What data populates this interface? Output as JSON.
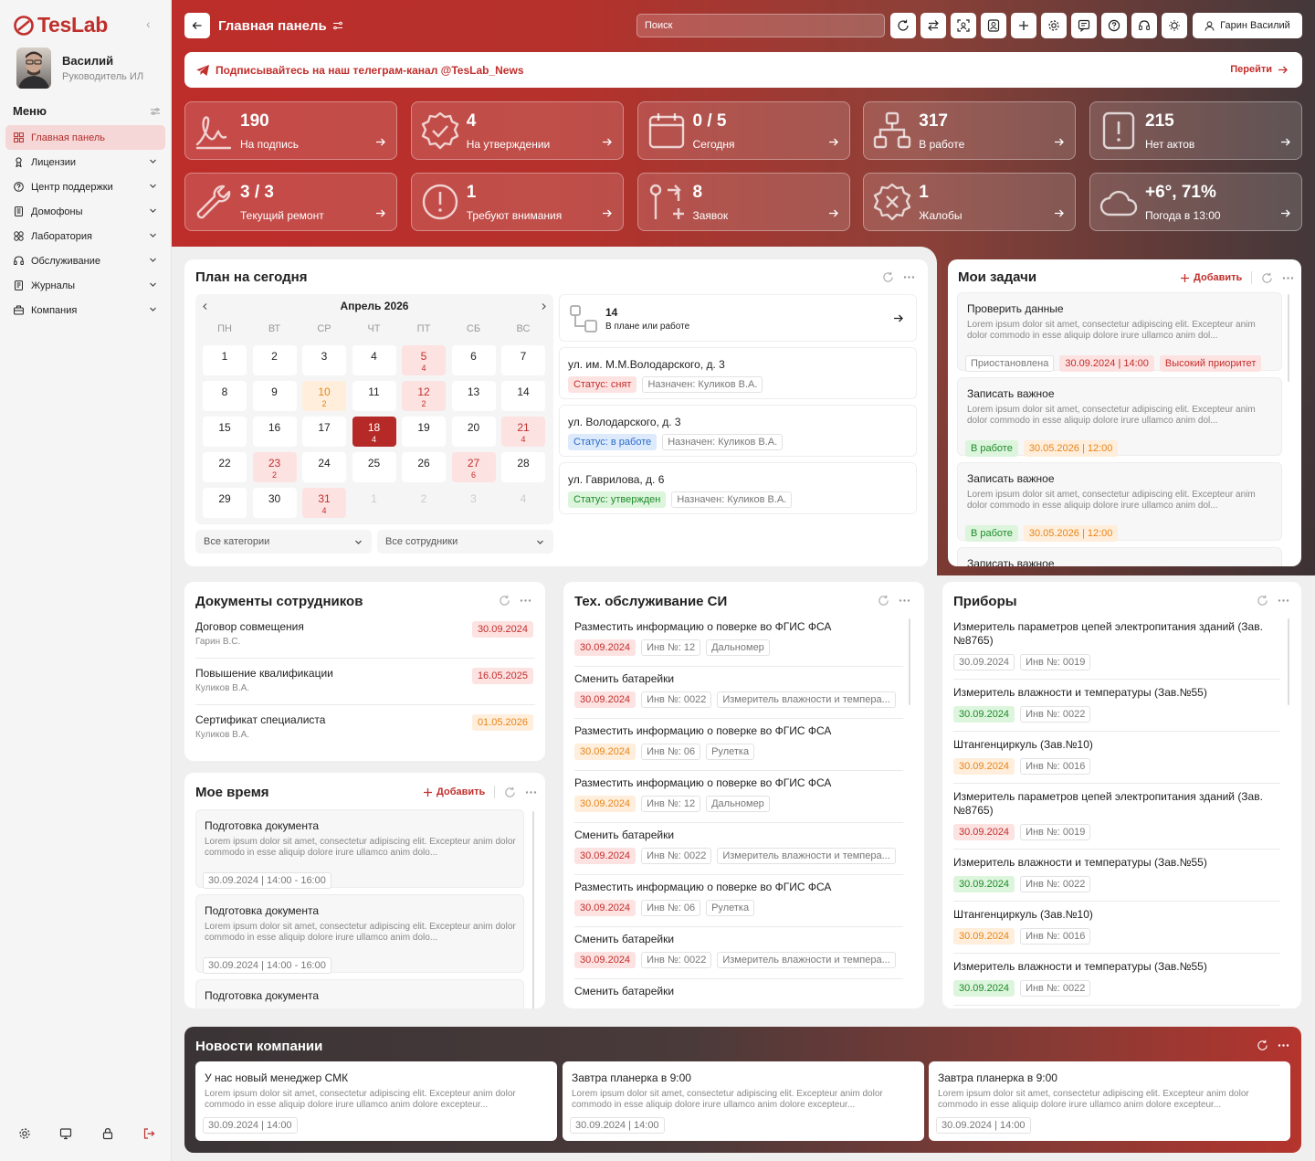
{
  "brand": {
    "logo": "TesLab"
  },
  "user": {
    "name": "Василий",
    "role": "Руководитель ИЛ"
  },
  "menu": {
    "title": "Меню",
    "items": [
      {
        "label": "Главная панель",
        "icon": "dashboard-icon"
      },
      {
        "label": "Лицензии",
        "icon": "license-icon"
      },
      {
        "label": "Центр поддержки",
        "icon": "support-icon"
      },
      {
        "label": "Домофоны",
        "icon": "intercom-icon"
      },
      {
        "label": "Лаборатория",
        "icon": "lab-icon"
      },
      {
        "label": "Обслуживание",
        "icon": "service-icon"
      },
      {
        "label": "Журналы",
        "icon": "journal-icon"
      },
      {
        "label": "Компания",
        "icon": "company-icon"
      }
    ]
  },
  "header": {
    "title": "Главная панель",
    "search_placeholder": "Поиск",
    "user_button": "Гарин Василий"
  },
  "banner": {
    "text": "Подписывайтесь на наш телеграм-канал @TesLab_News",
    "action": "Перейти"
  },
  "stats": [
    {
      "value": "190",
      "label": "На подпись",
      "icon": "signature-icon"
    },
    {
      "value": "4",
      "label": "На утверждении",
      "icon": "approval-icon"
    },
    {
      "value": "0 / 5",
      "label": "Сегодня",
      "icon": "calendar-icon"
    },
    {
      "value": "317",
      "label": "В работе",
      "icon": "hierarchy-icon"
    },
    {
      "value": "215",
      "label": "Нет актов",
      "icon": "alert-doc-icon"
    },
    {
      "value": "3 / 3",
      "label": "Текущий ремонт",
      "icon": "wrench-icon"
    },
    {
      "value": "1",
      "label": "Требуют внимания",
      "icon": "warning-icon"
    },
    {
      "value": "8",
      "label": "Заявок",
      "icon": "request-icon"
    },
    {
      "value": "1",
      "label": "Жалобы",
      "icon": "complaint-icon"
    },
    {
      "value": "+6°, 71%",
      "label": "Погода в 13:00",
      "icon": "cloud-icon"
    }
  ],
  "plan": {
    "title": "План на сегодня",
    "month": "Апрель 2026",
    "dows": [
      "ПН",
      "ВТ",
      "СР",
      "ЧТ",
      "ПТ",
      "СБ",
      "ВС"
    ],
    "days": [
      {
        "d": "1",
        "n": ""
      },
      {
        "d": "2",
        "n": ""
      },
      {
        "d": "3",
        "n": ""
      },
      {
        "d": "4",
        "n": ""
      },
      {
        "d": "5",
        "n": "4",
        "s": "ev"
      },
      {
        "d": "6",
        "n": ""
      },
      {
        "d": "7",
        "n": ""
      },
      {
        "d": "8",
        "n": ""
      },
      {
        "d": "9",
        "n": ""
      },
      {
        "d": "10",
        "n": "2",
        "s": "warn"
      },
      {
        "d": "11",
        "n": ""
      },
      {
        "d": "12",
        "n": "2",
        "s": "ev"
      },
      {
        "d": "13",
        "n": ""
      },
      {
        "d": "14",
        "n": ""
      },
      {
        "d": "15",
        "n": ""
      },
      {
        "d": "16",
        "n": ""
      },
      {
        "d": "17",
        "n": ""
      },
      {
        "d": "18",
        "n": "4",
        "s": "today"
      },
      {
        "d": "19",
        "n": ""
      },
      {
        "d": "20",
        "n": ""
      },
      {
        "d": "21",
        "n": "4",
        "s": "ev"
      },
      {
        "d": "22",
        "n": ""
      },
      {
        "d": "23",
        "n": "2",
        "s": "ev"
      },
      {
        "d": "24",
        "n": ""
      },
      {
        "d": "25",
        "n": ""
      },
      {
        "d": "26",
        "n": ""
      },
      {
        "d": "27",
        "n": "6",
        "s": "ev"
      },
      {
        "d": "28",
        "n": ""
      },
      {
        "d": "29",
        "n": ""
      },
      {
        "d": "30",
        "n": ""
      },
      {
        "d": "31",
        "n": "4",
        "s": "ev"
      },
      {
        "d": "1",
        "n": "",
        "s": "off"
      },
      {
        "d": "2",
        "n": "",
        "s": "off"
      },
      {
        "d": "3",
        "n": "",
        "s": "off"
      },
      {
        "d": "4",
        "n": "",
        "s": "off"
      }
    ],
    "filter_category": "Все категории",
    "filter_staff": "Все сотрудники",
    "summary": {
      "count": "14",
      "label": "В плане или работе"
    },
    "addresses": [
      {
        "addr": "ул. им. М.М.Володарского, д. 3",
        "status": "Статус: снят",
        "status_color": "red",
        "assignee": "Назначен: Куликов В.А."
      },
      {
        "addr": "ул. Володарского, д. 3",
        "status": "Статус: в работе",
        "status_color": "blue",
        "assignee": "Назначен: Куликов В.А."
      },
      {
        "addr": "ул. Гаврилова, д. 6",
        "status": "Статус: утвержден",
        "status_color": "green",
        "assignee": "Назначен: Куликов В.А."
      }
    ]
  },
  "tasks": {
    "title": "Мои задачи",
    "add": "Добавить",
    "items": [
      {
        "title": "Проверить данные",
        "desc": "Lorem ipsum dolor sit amet, consectetur adipiscing elit. Excepteur anim dolor commodo in esse aliquip dolore irure ullamco anim dol...",
        "tags": [
          {
            "t": "Приостановлена",
            "c": ""
          },
          {
            "t": "30.09.2024 | 14:00",
            "c": "red"
          },
          {
            "t": "Высокий приоритет",
            "c": "red"
          }
        ]
      },
      {
        "title": "Записать важное",
        "desc": "Lorem ipsum dolor sit amet, consectetur adipiscing elit. Excepteur anim dolor commodo in esse aliquip dolore irure ullamco anim dol...",
        "tags": [
          {
            "t": "В работе",
            "c": "green"
          },
          {
            "t": "30.05.2026 | 12:00",
            "c": "orange"
          }
        ]
      },
      {
        "title": "Записать важное",
        "desc": "Lorem ipsum dolor sit amet, consectetur adipiscing elit. Excepteur anim dolor commodo in esse aliquip dolore irure ullamco anim dol...",
        "tags": [
          {
            "t": "В работе",
            "c": "green"
          },
          {
            "t": "30.05.2026 | 12:00",
            "c": "orange"
          }
        ]
      },
      {
        "title": "Записать важное",
        "desc": "",
        "tags": []
      }
    ]
  },
  "docs": {
    "title": "Документы сотрудников",
    "items": [
      {
        "title": "Договор совмещения",
        "person": "Гарин В.С.",
        "date": "30.09.2024",
        "c": "red"
      },
      {
        "title": "Повышение квалификации",
        "person": "Куликов В.А.",
        "date": "16.05.2025",
        "c": "red"
      },
      {
        "title": "Сертификат специалиста",
        "person": "Куликов В.А.",
        "date": "01.05.2026",
        "c": "orange"
      }
    ]
  },
  "time": {
    "title": "Мое время",
    "add": "Добавить",
    "items": [
      {
        "title": "Подготовка документа",
        "desc": "Lorem ipsum dolor sit amet, consectetur adipiscing elit. Excepteur anim dolor commodo in esse aliquip dolore irure ullamco anim dolo...",
        "tag": "30.09.2024 | 14:00 - 16:00"
      },
      {
        "title": "Подготовка документа",
        "desc": "Lorem ipsum dolor sit amet, consectetur adipiscing elit. Excepteur anim dolor commodo in esse aliquip dolore irure ullamco anim dolo...",
        "tag": "30.09.2024 | 14:00 - 16:00"
      },
      {
        "title": "Подготовка документа",
        "desc": "",
        "tag": ""
      }
    ]
  },
  "maint": {
    "title": "Тех. обслуживание СИ",
    "items": [
      {
        "title": "Разместить информацию о поверке во ФГИС ФСА",
        "date": "30.09.2024",
        "c": "red",
        "inv": "Инв №: 12",
        "dev": "Дальномер"
      },
      {
        "title": "Сменить батарейки",
        "date": "30.09.2024",
        "c": "red",
        "inv": "Инв №: 0022",
        "dev": "Измеритель влажности и темпера..."
      },
      {
        "title": "Разместить информацию о поверке во ФГИС ФСА",
        "date": "30.09.2024",
        "c": "orange",
        "inv": "Инв №: 06",
        "dev": "Рулетка"
      },
      {
        "title": "Разместить информацию о поверке во ФГИС ФСА",
        "date": "30.09.2024",
        "c": "orange",
        "inv": "Инв №: 12",
        "dev": "Дальномер"
      },
      {
        "title": "Сменить батарейки",
        "date": "30.09.2024",
        "c": "red",
        "inv": "Инв №: 0022",
        "dev": "Измеритель влажности и темпера..."
      },
      {
        "title": "Разместить информацию о поверке во ФГИС ФСА",
        "date": "30.09.2024",
        "c": "red",
        "inv": "Инв №: 06",
        "dev": "Рулетка"
      },
      {
        "title": "Сменить батарейки",
        "date": "30.09.2024",
        "c": "red",
        "inv": "Инв №: 0022",
        "dev": "Измеритель влажности и темпера..."
      },
      {
        "title": "Сменить батарейки",
        "date": "",
        "c": "red",
        "inv": "",
        "dev": ""
      }
    ]
  },
  "devices": {
    "title": "Приборы",
    "items": [
      {
        "title": "Измеритель параметров цепей электропитания зданий (Зав.№8765)",
        "date": "30.09.2024",
        "c": "",
        "inv": "Инв №: 0019"
      },
      {
        "title": "Измеритель влажности и температуры (Зав.№55)",
        "date": "30.09.2024",
        "c": "green",
        "inv": "Инв №: 0022"
      },
      {
        "title": "Штангенциркуль (Зав.№10)",
        "date": "30.09.2024",
        "c": "orange",
        "inv": "Инв №: 0016"
      },
      {
        "title": "Измеритель параметров цепей электропитания зданий (Зав.№8765)",
        "date": "30.09.2024",
        "c": "red",
        "inv": "Инв №: 0019"
      },
      {
        "title": "Измеритель влажности и температуры (Зав.№55)",
        "date": "30.09.2024",
        "c": "green",
        "inv": "Инв №: 0022"
      },
      {
        "title": "Штангенциркуль (Зав.№10)",
        "date": "30.09.2024",
        "c": "orange",
        "inv": "Инв №: 0016"
      },
      {
        "title": "Измеритель влажности и температуры (Зав.№55)",
        "date": "30.09.2024",
        "c": "green",
        "inv": "Инв №: 0022"
      }
    ]
  },
  "news": {
    "title": "Новости компании",
    "items": [
      {
        "title": "У нас новый менеджер СМК",
        "desc": "Lorem ipsum dolor sit amet, consectetur adipiscing elit. Excepteur anim dolor commodo in esse aliquip dolore irure ullamco anim dolore excepteur...",
        "date": "30.09.2024 | 14:00"
      },
      {
        "title": "Завтра планерка в 9:00",
        "desc": "Lorem ipsum dolor sit amet, consectetur adipiscing elit. Excepteur anim dolor commodo in esse aliquip dolore irure ullamco anim dolore excepteur...",
        "date": "30.09.2024 | 14:00"
      },
      {
        "title": "Завтра планерка в 9:00",
        "desc": "Lorem ipsum dolor sit amet, consectetur adipiscing elit. Excepteur anim dolor commodo in esse aliquip dolore irure ullamco anim dolore excepteur...",
        "date": "30.09.2024 | 14:00"
      }
    ]
  },
  "colors": {
    "accent": "#c12f2c",
    "hero_dark": "#43383a"
  }
}
